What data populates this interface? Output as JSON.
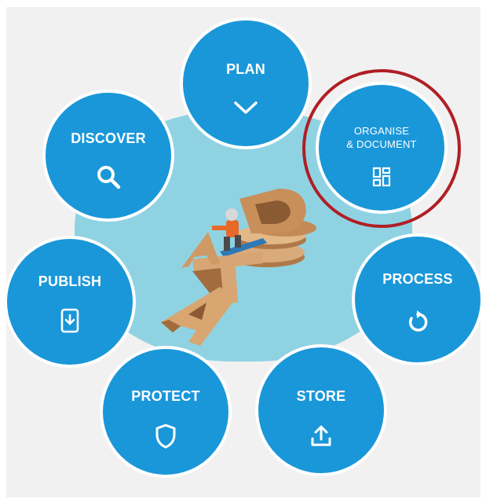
{
  "nodes": {
    "plan": {
      "label": "PLAN",
      "icon": "chevron-down-icon"
    },
    "organise": {
      "line1": "ORGANISE",
      "line2": "& DOCUMENT",
      "icon": "grid-layout-icon"
    },
    "process": {
      "label": "PROCESS",
      "icon": "refresh-icon"
    },
    "store": {
      "label": "STORE",
      "icon": "upload-icon"
    },
    "protect": {
      "label": "PROTECT",
      "icon": "shield-icon"
    },
    "publish": {
      "label": "PUBLISH",
      "icon": "download-file-icon"
    },
    "discover": {
      "label": "DISCOVER",
      "icon": "search-icon"
    }
  },
  "colors": {
    "node": "#1a97d9",
    "hub": "#8fd3e3",
    "highlight": "#b01e24",
    "background": "#f1f1f1"
  },
  "highlighted_node": "organise"
}
